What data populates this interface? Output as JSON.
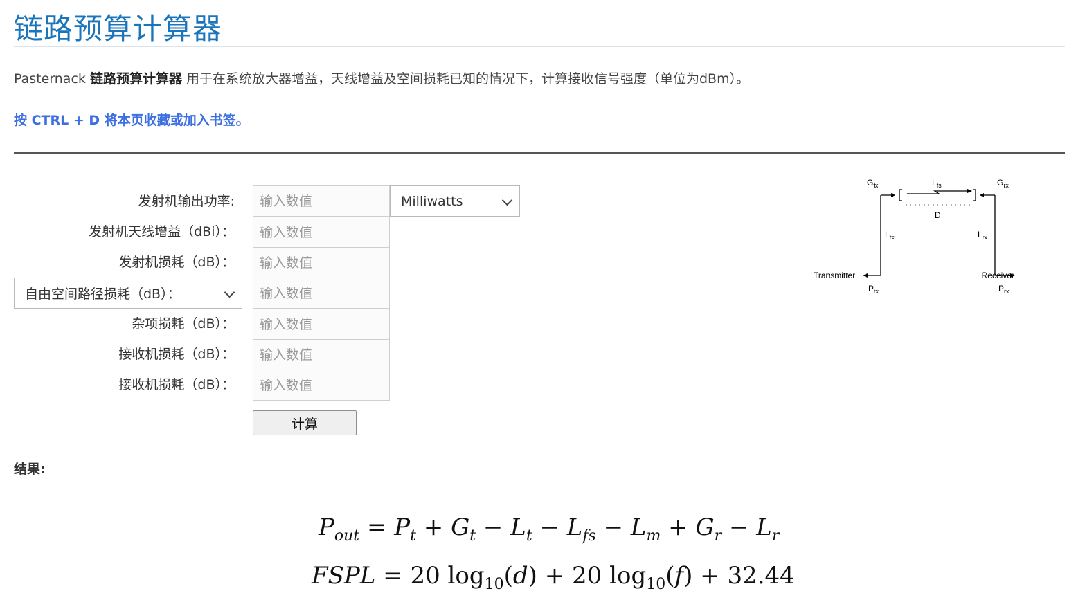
{
  "page": {
    "title": "链路预算计算器",
    "intro_prefix": "Pasternack ",
    "intro_bold": "链路预算计算器",
    "intro_suffix": " 用于在系统放大器增益，天线增益及空间损耗已知的情况下，计算接收信号强度（单位为dBm）。",
    "bookmark_hint": "按 CTRL + D 将本页收藏或加入书签。"
  },
  "form": {
    "placeholder": "输入数值",
    "tx_power_label": "发射机输出功率:",
    "tx_power_unit": "Milliwatts",
    "tx_gain_label": "发射机天线增益（dBi）：",
    "tx_loss_label": "发射机损耗（dB）：",
    "fspl_select": "自由空间路径损耗（dB）：",
    "misc_loss_label": "杂项损耗（dB）：",
    "rx_loss_label": "接收机损耗（dB）：",
    "rx_loss2_label": "接收机损耗（dB）：",
    "calculate": "计算",
    "result_label": "结果:"
  },
  "diagram": {
    "gtx": "G",
    "gtx_sub": "tx",
    "grx": "G",
    "grx_sub": "rx",
    "lfs": "L",
    "lfs_sub": "fs",
    "d": "D",
    "ltx": "L",
    "ltx_sub": "tx",
    "lrx": "L",
    "lrx_sub": "rx",
    "transmitter": "Transmitter",
    "receiver": "Receiver",
    "ptx": "P",
    "ptx_sub": "tx",
    "prx": "P",
    "prx_sub": "rx"
  },
  "colors": {
    "title": "#1b75bb",
    "bookmark": "#3d6fe0",
    "rule": "#555555"
  },
  "icons": {
    "select_arrow": "chevron-down-icon"
  }
}
